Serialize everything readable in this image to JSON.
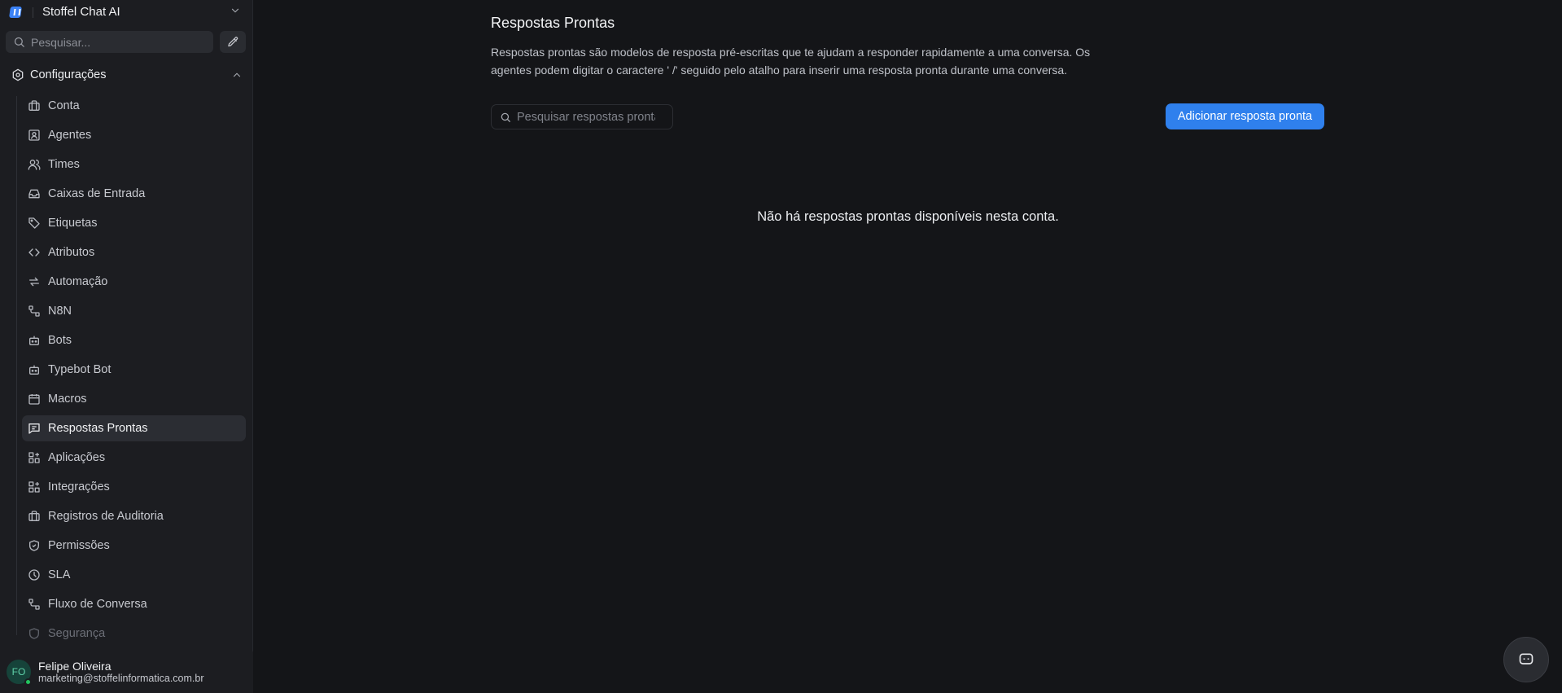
{
  "brand": {
    "name": "Stoffel Chat AI"
  },
  "sidebar": {
    "search_placeholder": "Pesquisar...",
    "section": {
      "label": "Configurações"
    },
    "items": [
      {
        "label": "Conta",
        "icon": "briefcase-icon"
      },
      {
        "label": "Agentes",
        "icon": "contact-square-icon"
      },
      {
        "label": "Times",
        "icon": "users-icon"
      },
      {
        "label": "Caixas de Entrada",
        "icon": "inbox-icon"
      },
      {
        "label": "Etiquetas",
        "icon": "tag-icon"
      },
      {
        "label": "Atributos",
        "icon": "code-icon"
      },
      {
        "label": "Automação",
        "icon": "arrows-repeat-icon"
      },
      {
        "label": "N8N",
        "icon": "workflow-icon"
      },
      {
        "label": "Bots",
        "icon": "bot-icon"
      },
      {
        "label": "Typebot Bot",
        "icon": "bot-icon"
      },
      {
        "label": "Macros",
        "icon": "calendar-icon"
      },
      {
        "label": "Respostas Prontas",
        "icon": "message-square-icon",
        "active": true
      },
      {
        "label": "Aplicações",
        "icon": "apps-icon"
      },
      {
        "label": "Integrações",
        "icon": "apps-icon"
      },
      {
        "label": "Registros de Auditoria",
        "icon": "briefcase-icon"
      },
      {
        "label": "Permissões",
        "icon": "shield-icon"
      },
      {
        "label": "SLA",
        "icon": "clock-icon"
      },
      {
        "label": "Fluxo de Conversa",
        "icon": "workflow-icon"
      },
      {
        "label": "Segurança",
        "icon": "shield-icon"
      }
    ]
  },
  "user": {
    "initials": "FO",
    "name": "Felipe Oliveira",
    "email": "marketing@stoffelinformatica.com.br"
  },
  "main": {
    "title": "Respostas Prontas",
    "description": "Respostas prontas são modelos de resposta pré-escritas que te ajudam a responder rapidamente a uma conversa. Os agentes podem digitar o caractere ' /' seguido pelo atalho para inserir uma resposta pronta durante uma conversa.",
    "search_placeholder": "Pesquisar respostas prontas",
    "add_button": "Adicionar resposta pronta",
    "empty_message": "Não há respostas prontas disponíveis nesta conta."
  },
  "colors": {
    "background": "#141518",
    "sidebar": "#1c1d21",
    "accent": "#2f80ed",
    "status_online": "#22c55e"
  }
}
